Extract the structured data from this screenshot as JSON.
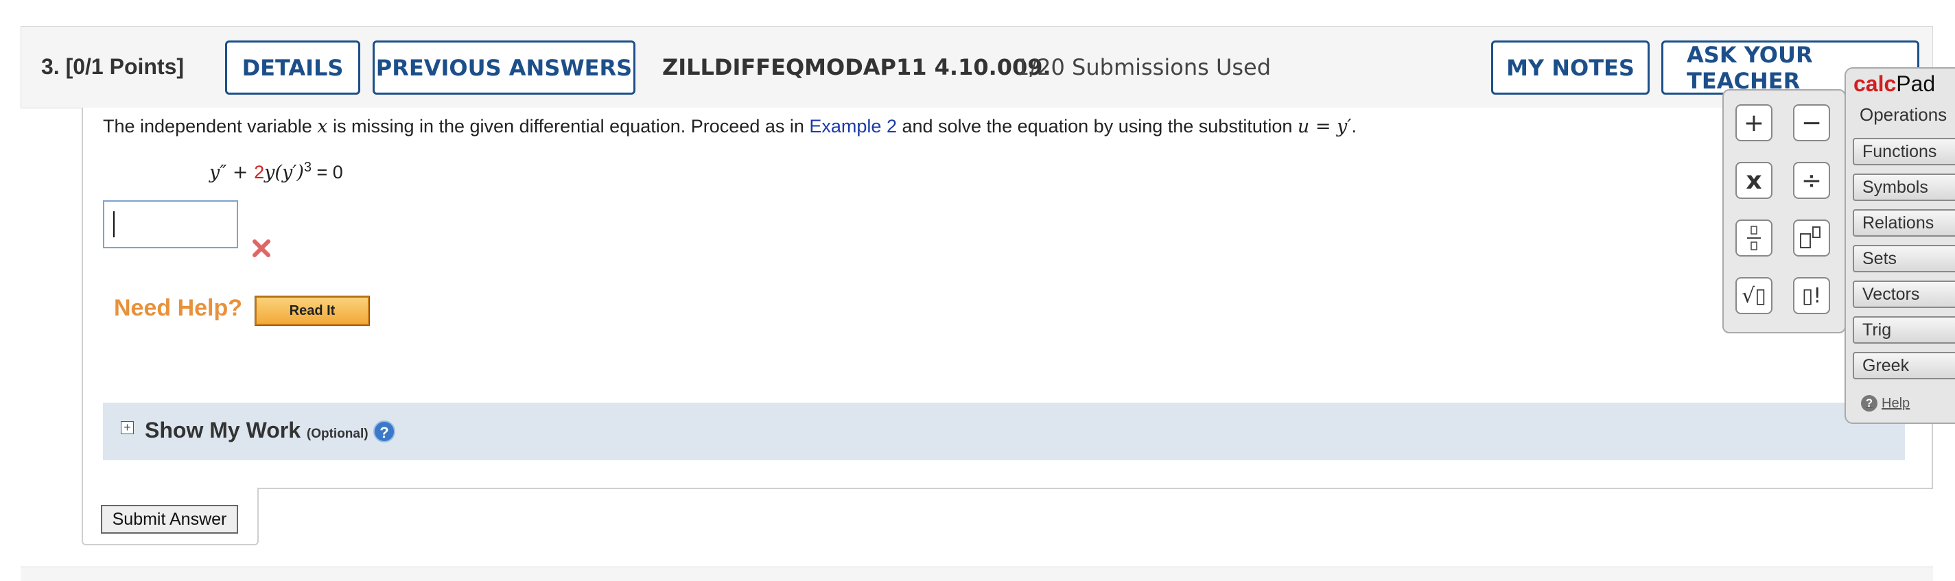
{
  "header": {
    "question_number": "3.",
    "points": "[0/1 Points]",
    "details_label": "DETAILS",
    "previous_answers_label": "PREVIOUS ANSWERS",
    "assignment_id": "ZILLDIFFEQMODAP11 4.10.009.",
    "submissions": "1/20 Submissions Used",
    "my_notes_label": "MY NOTES",
    "ask_teacher_label": "ASK YOUR TEACHER"
  },
  "question": {
    "prompt_part1": "The independent variable ",
    "prompt_var": "x",
    "prompt_part2": " is missing in the given differential equation. Proceed as in ",
    "prompt_link": "Example 2",
    "prompt_part3": " and solve the equation by using the substitution ",
    "prompt_sub": "u = y′",
    "prompt_end": ".",
    "equation": {
      "lhs_start": "y″ + ",
      "coefficient": "2",
      "term": "y(y′)",
      "exponent": "3",
      "rhs": " = 0"
    },
    "answer_value": "",
    "status_icon": "wrong-x-icon"
  },
  "help": {
    "need_help_label": "Need Help?",
    "read_it_label": "Read It"
  },
  "show_my_work": {
    "title": "Show My Work",
    "optional": "(Optional)"
  },
  "submit_label": "Submit Answer",
  "calcpad": {
    "brand": "calc",
    "name": "Pad",
    "active_tab": "Operations",
    "keys": [
      "+",
      "−",
      "x",
      "÷",
      "fraction",
      "power",
      "√▯",
      "▯!"
    ],
    "tabs": [
      "Functions",
      "Symbols",
      "Relations",
      "Sets",
      "Vectors",
      "Trig",
      "Greek"
    ],
    "help_label": "Help"
  },
  "colors": {
    "accent": "#1c4f8a",
    "link": "#1a3aa8",
    "error": "#e06666",
    "need_help": "#e8913b",
    "show_work_bg": "#dde6ef",
    "calcpad_brand": "#d21e1e"
  }
}
